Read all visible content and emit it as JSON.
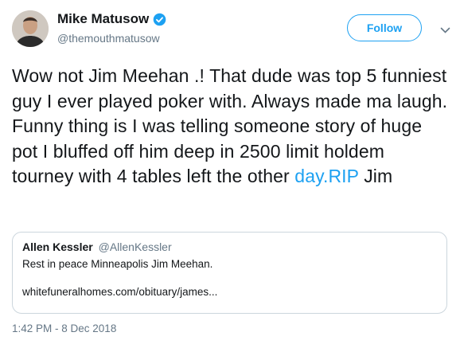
{
  "author": {
    "name": "Mike Matusow",
    "handle": "@themouthmatusow"
  },
  "follow_label": "Follow",
  "tweet": {
    "text_before_link": "Wow not Jim Meehan .! That dude was top 5 funniest guy I ever played poker with. Always made ma laugh. Funny thing is I was telling someone story of huge pot I bluffed off him deep in 2500 limit holdem tourney with 4 tables left the other ",
    "link_text": "day.RIP",
    "text_after_link": " Jim"
  },
  "quote": {
    "name": "Allen Kessler",
    "handle": "@AllenKessler",
    "text": "Rest in peace Minneapolis Jim Meehan.",
    "link": "whitefuneralhomes.com/obituary/james..."
  },
  "timestamp": "1:42 PM - 8 Dec 2018",
  "colors": {
    "accent": "#1da1f2",
    "text": "#14171a",
    "secondary": "#657786",
    "border": "#ccd6dd"
  }
}
